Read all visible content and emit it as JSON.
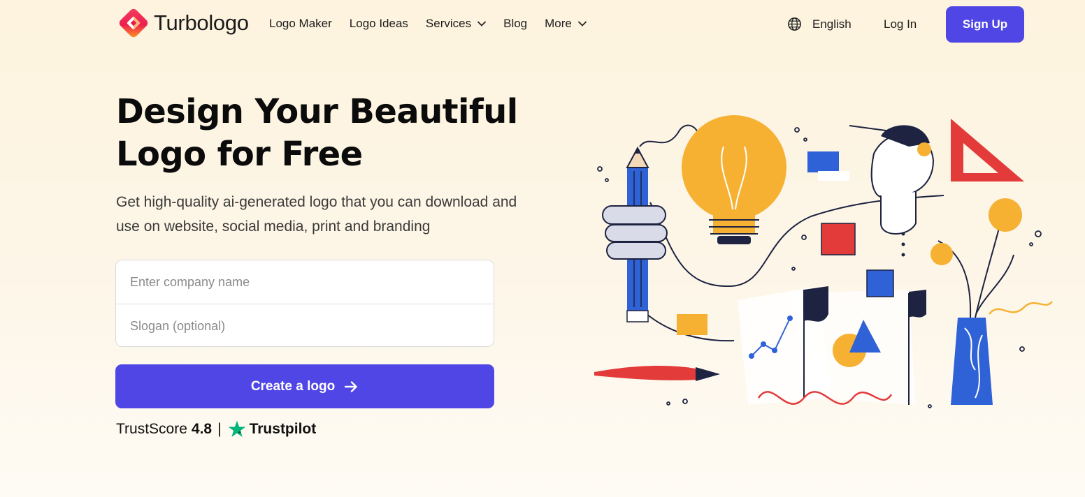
{
  "brand": {
    "name": "Turbologo",
    "logo_icon": "turbologo-mark"
  },
  "nav": {
    "items": [
      {
        "label": "Logo Maker",
        "dropdown": false
      },
      {
        "label": "Logo Ideas",
        "dropdown": false
      },
      {
        "label": "Services",
        "dropdown": true
      },
      {
        "label": "Blog",
        "dropdown": false
      },
      {
        "label": "More",
        "dropdown": true
      }
    ]
  },
  "header": {
    "language": {
      "label": "English",
      "icon": "globe-icon"
    },
    "login_label": "Log In",
    "signup_label": "Sign Up"
  },
  "hero": {
    "title_line1": "Design Your Beautiful",
    "title_line2": "Logo for Free",
    "subtitle_line1": "Get high-quality ai-generated logo that you can download and",
    "subtitle_line2": "use on website, social media, print and branding"
  },
  "form": {
    "company_placeholder": "Enter company name",
    "company_value": "",
    "slogan_placeholder": "Slogan (optional)",
    "slogan_value": "",
    "submit_label": "Create a logo",
    "submit_icon": "arrow-right-icon"
  },
  "trust": {
    "label": "TrustScore",
    "score": "4.8",
    "separator": "|",
    "brand": "Trustpilot",
    "icon": "trustpilot-star-icon"
  },
  "colors": {
    "accent": "#5046e5",
    "background": "#fdf4e3",
    "trustpilot_green": "#00b67a",
    "illustration_blue": "#2f62d6",
    "illustration_yellow": "#f6b133",
    "illustration_red": "#e33a3a"
  }
}
